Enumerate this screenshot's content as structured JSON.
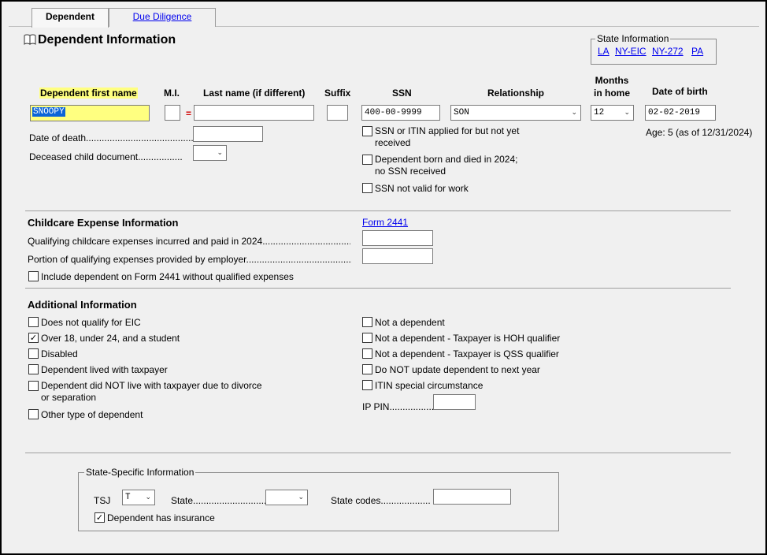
{
  "tabs": {
    "dependent": "Dependent",
    "due_diligence": "Due Diligence"
  },
  "page_title": "Dependent Information",
  "state_info": {
    "title": "State Information",
    "links": [
      "LA",
      "NY-EIC",
      "NY-272",
      "PA"
    ]
  },
  "headers": {
    "first_name": "Dependent first name",
    "mi": "M.I.",
    "last_name": "Last name (if different)",
    "suffix": "Suffix",
    "ssn": "SSN",
    "relationship": "Relationship",
    "months_line1": "Months",
    "months_line2": "in home",
    "dob": "Date of birth"
  },
  "fields": {
    "first_name": "SNOOPY",
    "mi": "",
    "equals": "=",
    "last_name": "",
    "suffix": "",
    "ssn": "400-00-9999",
    "relationship": "SON",
    "months": "12",
    "dob": "02-02-2019",
    "age": "Age: 5 (as of 12/31/2024)",
    "date_of_death_label": "Date of death...........................................",
    "date_of_death": "",
    "deceased_doc_label": "Deceased child document.................",
    "deceased_doc": ""
  },
  "ssn_checks": [
    {
      "line1": "SSN or ITIN applied for but not yet",
      "line2": "received",
      "checked": false
    },
    {
      "line1": "Dependent born and died in 2024;",
      "line2": "no SSN received",
      "checked": false
    },
    {
      "line1": "SSN not valid for work",
      "line2": "",
      "checked": false
    }
  ],
  "childcare": {
    "title": "Childcare Expense Information",
    "form_link": "Form 2441",
    "expenses_label": "Qualifying childcare expenses incurred and paid in 2024...................................",
    "expenses": "",
    "employer_label": "Portion of qualifying expenses provided by employer.............................................",
    "employer": "",
    "include_label": "Include dependent on Form 2441 without qualified expenses",
    "include_checked": false
  },
  "additional": {
    "title": "Additional Information",
    "left": [
      {
        "label": "Does not qualify for EIC",
        "line2": "",
        "checked": false
      },
      {
        "label": "Over 18, under 24, and a student",
        "line2": "",
        "checked": true
      },
      {
        "label": "Disabled",
        "line2": "",
        "checked": false
      },
      {
        "label": "Dependent lived with taxpayer",
        "line2": "",
        "checked": false
      },
      {
        "label": "Dependent did NOT live with taxpayer due to divorce",
        "line2": "or separation",
        "checked": false
      },
      {
        "label": "Other type of dependent",
        "line2": "",
        "checked": false
      }
    ],
    "right": [
      {
        "label": "Not a dependent",
        "checked": false
      },
      {
        "label": "Not a dependent - Taxpayer is HOH qualifier",
        "checked": false
      },
      {
        "label": "Not a dependent - Taxpayer is QSS qualifier",
        "checked": false
      },
      {
        "label": "Do NOT update dependent to next year",
        "checked": false
      },
      {
        "label": "ITIN special circumstance",
        "checked": false
      }
    ],
    "ip_pin_label": "IP PIN.................",
    "ip_pin": ""
  },
  "state_specific": {
    "title": "State-Specific Information",
    "tsj_label": "TSJ",
    "tsj": "T",
    "state_label": "State............................",
    "state": "",
    "codes_label": "State codes...................",
    "codes": "",
    "insurance_label": "Dependent has insurance",
    "insurance_checked": true
  },
  "colors": {
    "highlight": "#ffff80",
    "link": "#0000ee",
    "selection": "#0a64d8"
  }
}
